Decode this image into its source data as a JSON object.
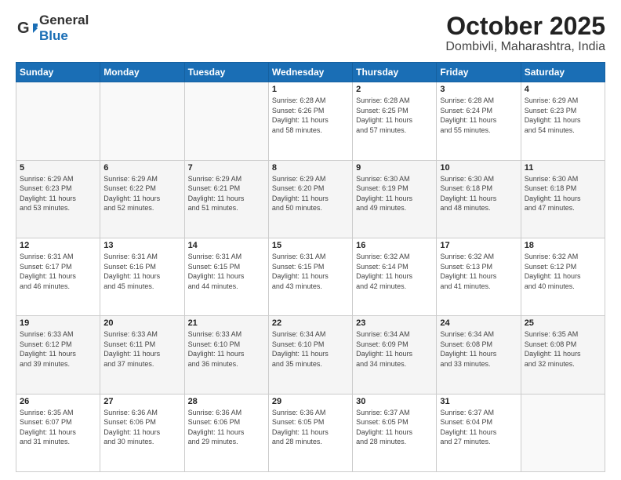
{
  "header": {
    "logo_general": "General",
    "logo_blue": "Blue",
    "month": "October 2025",
    "location": "Dombivli, Maharashtra, India"
  },
  "weekdays": [
    "Sunday",
    "Monday",
    "Tuesday",
    "Wednesday",
    "Thursday",
    "Friday",
    "Saturday"
  ],
  "weeks": [
    [
      {
        "day": "",
        "info": ""
      },
      {
        "day": "",
        "info": ""
      },
      {
        "day": "",
        "info": ""
      },
      {
        "day": "1",
        "info": "Sunrise: 6:28 AM\nSunset: 6:26 PM\nDaylight: 11 hours\nand 58 minutes."
      },
      {
        "day": "2",
        "info": "Sunrise: 6:28 AM\nSunset: 6:25 PM\nDaylight: 11 hours\nand 57 minutes."
      },
      {
        "day": "3",
        "info": "Sunrise: 6:28 AM\nSunset: 6:24 PM\nDaylight: 11 hours\nand 55 minutes."
      },
      {
        "day": "4",
        "info": "Sunrise: 6:29 AM\nSunset: 6:23 PM\nDaylight: 11 hours\nand 54 minutes."
      }
    ],
    [
      {
        "day": "5",
        "info": "Sunrise: 6:29 AM\nSunset: 6:23 PM\nDaylight: 11 hours\nand 53 minutes."
      },
      {
        "day": "6",
        "info": "Sunrise: 6:29 AM\nSunset: 6:22 PM\nDaylight: 11 hours\nand 52 minutes."
      },
      {
        "day": "7",
        "info": "Sunrise: 6:29 AM\nSunset: 6:21 PM\nDaylight: 11 hours\nand 51 minutes."
      },
      {
        "day": "8",
        "info": "Sunrise: 6:29 AM\nSunset: 6:20 PM\nDaylight: 11 hours\nand 50 minutes."
      },
      {
        "day": "9",
        "info": "Sunrise: 6:30 AM\nSunset: 6:19 PM\nDaylight: 11 hours\nand 49 minutes."
      },
      {
        "day": "10",
        "info": "Sunrise: 6:30 AM\nSunset: 6:18 PM\nDaylight: 11 hours\nand 48 minutes."
      },
      {
        "day": "11",
        "info": "Sunrise: 6:30 AM\nSunset: 6:18 PM\nDaylight: 11 hours\nand 47 minutes."
      }
    ],
    [
      {
        "day": "12",
        "info": "Sunrise: 6:31 AM\nSunset: 6:17 PM\nDaylight: 11 hours\nand 46 minutes."
      },
      {
        "day": "13",
        "info": "Sunrise: 6:31 AM\nSunset: 6:16 PM\nDaylight: 11 hours\nand 45 minutes."
      },
      {
        "day": "14",
        "info": "Sunrise: 6:31 AM\nSunset: 6:15 PM\nDaylight: 11 hours\nand 44 minutes."
      },
      {
        "day": "15",
        "info": "Sunrise: 6:31 AM\nSunset: 6:15 PM\nDaylight: 11 hours\nand 43 minutes."
      },
      {
        "day": "16",
        "info": "Sunrise: 6:32 AM\nSunset: 6:14 PM\nDaylight: 11 hours\nand 42 minutes."
      },
      {
        "day": "17",
        "info": "Sunrise: 6:32 AM\nSunset: 6:13 PM\nDaylight: 11 hours\nand 41 minutes."
      },
      {
        "day": "18",
        "info": "Sunrise: 6:32 AM\nSunset: 6:12 PM\nDaylight: 11 hours\nand 40 minutes."
      }
    ],
    [
      {
        "day": "19",
        "info": "Sunrise: 6:33 AM\nSunset: 6:12 PM\nDaylight: 11 hours\nand 39 minutes."
      },
      {
        "day": "20",
        "info": "Sunrise: 6:33 AM\nSunset: 6:11 PM\nDaylight: 11 hours\nand 37 minutes."
      },
      {
        "day": "21",
        "info": "Sunrise: 6:33 AM\nSunset: 6:10 PM\nDaylight: 11 hours\nand 36 minutes."
      },
      {
        "day": "22",
        "info": "Sunrise: 6:34 AM\nSunset: 6:10 PM\nDaylight: 11 hours\nand 35 minutes."
      },
      {
        "day": "23",
        "info": "Sunrise: 6:34 AM\nSunset: 6:09 PM\nDaylight: 11 hours\nand 34 minutes."
      },
      {
        "day": "24",
        "info": "Sunrise: 6:34 AM\nSunset: 6:08 PM\nDaylight: 11 hours\nand 33 minutes."
      },
      {
        "day": "25",
        "info": "Sunrise: 6:35 AM\nSunset: 6:08 PM\nDaylight: 11 hours\nand 32 minutes."
      }
    ],
    [
      {
        "day": "26",
        "info": "Sunrise: 6:35 AM\nSunset: 6:07 PM\nDaylight: 11 hours\nand 31 minutes."
      },
      {
        "day": "27",
        "info": "Sunrise: 6:36 AM\nSunset: 6:06 PM\nDaylight: 11 hours\nand 30 minutes."
      },
      {
        "day": "28",
        "info": "Sunrise: 6:36 AM\nSunset: 6:06 PM\nDaylight: 11 hours\nand 29 minutes."
      },
      {
        "day": "29",
        "info": "Sunrise: 6:36 AM\nSunset: 6:05 PM\nDaylight: 11 hours\nand 28 minutes."
      },
      {
        "day": "30",
        "info": "Sunrise: 6:37 AM\nSunset: 6:05 PM\nDaylight: 11 hours\nand 28 minutes."
      },
      {
        "day": "31",
        "info": "Sunrise: 6:37 AM\nSunset: 6:04 PM\nDaylight: 11 hours\nand 27 minutes."
      },
      {
        "day": "",
        "info": ""
      }
    ]
  ]
}
